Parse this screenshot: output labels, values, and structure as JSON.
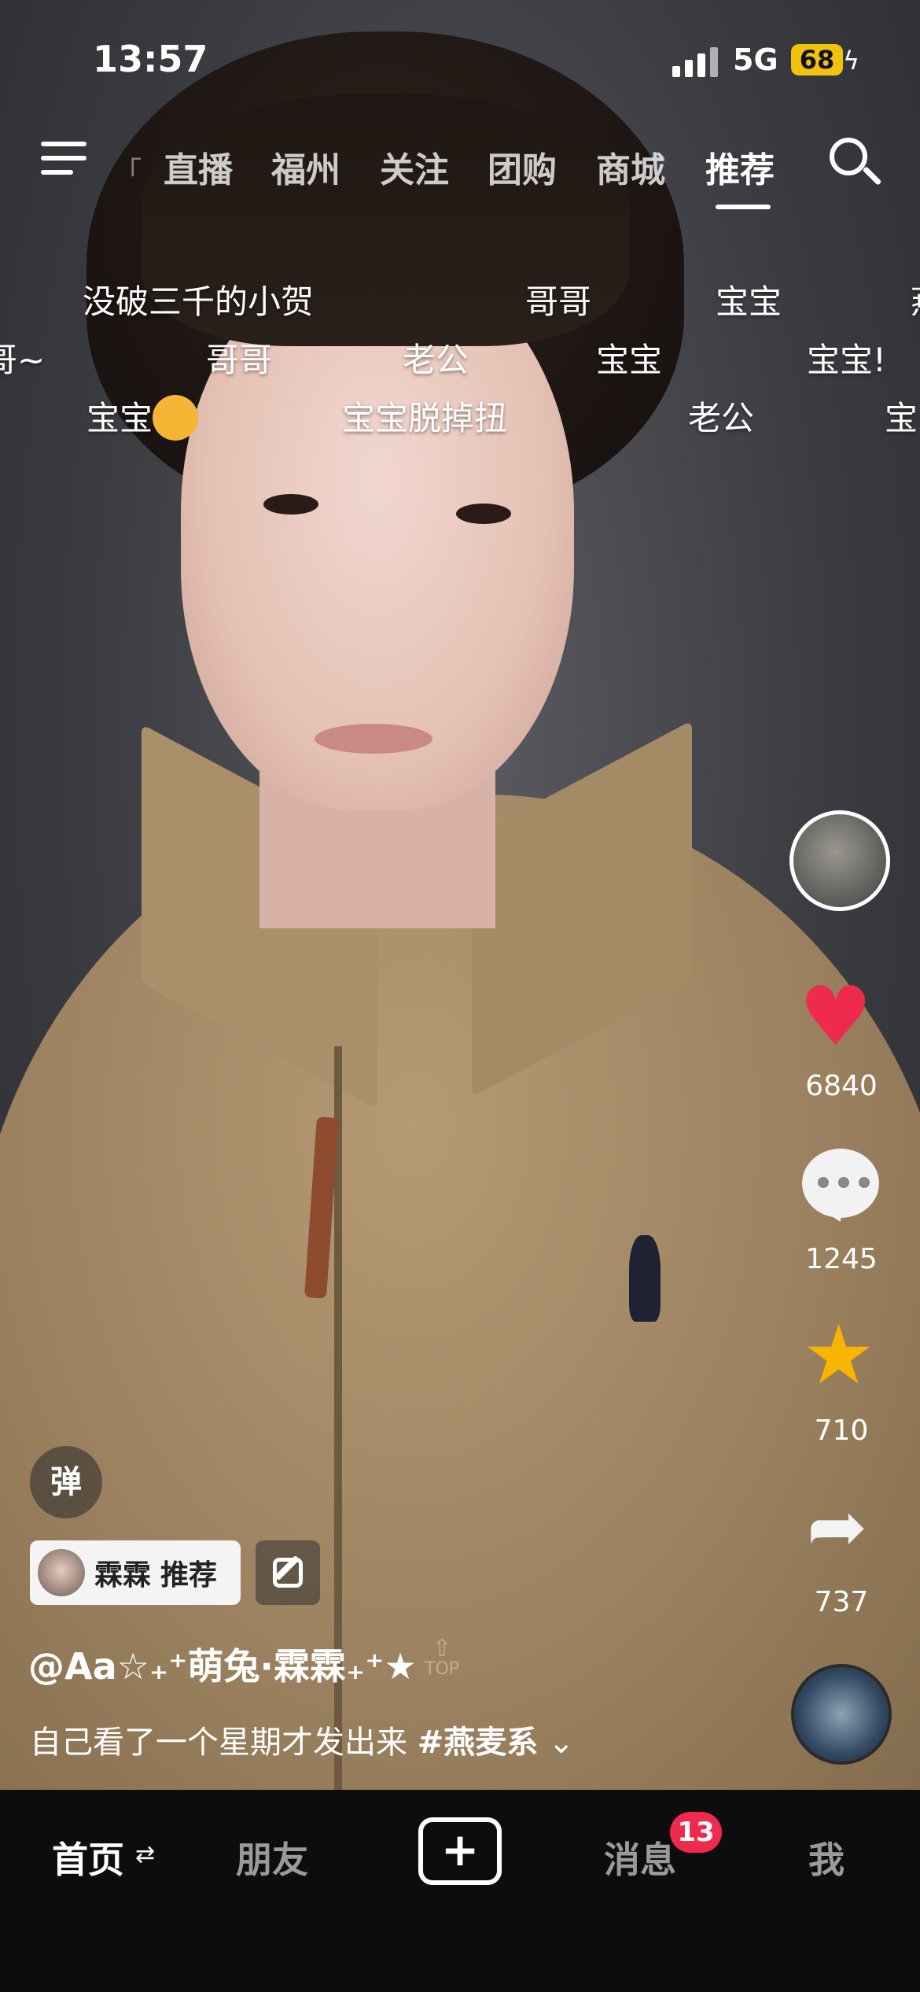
{
  "status_bar": {
    "time": "13:57",
    "network": "5G",
    "battery": "68"
  },
  "top_nav": {
    "tabs": [
      "直播",
      "福州",
      "关注",
      "团购",
      "商城",
      "推荐"
    ],
    "active_tab": "推荐",
    "edge_text": "「"
  },
  "danmaku": [
    "没破三千的小贺",
    "哥哥",
    "宝宝",
    "燕",
    "哥~",
    "哥哥",
    "老公",
    "宝宝",
    "宝宝!",
    "宝宝",
    "宝宝脱掉扭",
    "老公",
    "宝"
  ],
  "actions": {
    "likes": "6840",
    "comments": "1245",
    "favorites": "710",
    "shares": "737"
  },
  "post": {
    "danmu_toggle": "弹",
    "recommender": "霖霖",
    "recommend_label": "推荐",
    "author": "@Aa☆₊⁺萌兔·霖霖₊⁺★",
    "top_badge": "TOP",
    "caption": "自己看了一个星期才发出来",
    "hashtag": "#燕麦系",
    "expand": "⌄"
  },
  "bottom_nav": {
    "home": "首页",
    "friends": "朋友",
    "create": "+",
    "messages": "消息",
    "me": "我",
    "messages_badge": "13",
    "home_swap": "⇄"
  },
  "colors": {
    "like": "#ee2b4f",
    "favorite": "#f7b500",
    "badge": "#f0294e",
    "battery": "#f1c30f"
  }
}
